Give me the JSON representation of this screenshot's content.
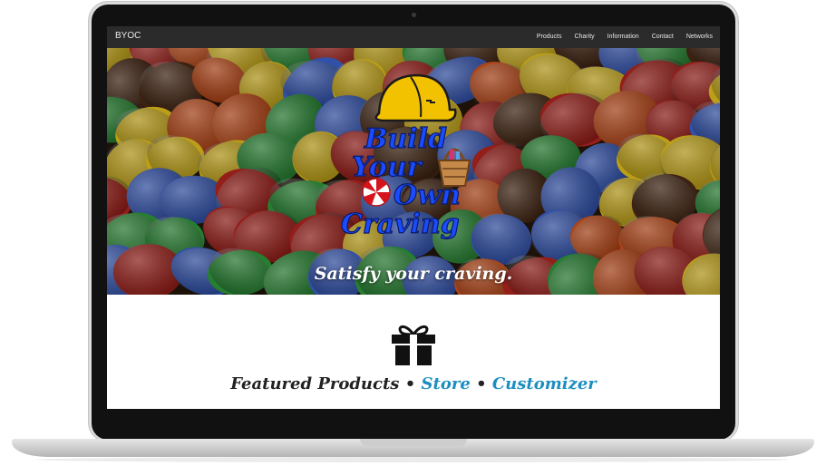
{
  "navbar": {
    "brand": "BYOC",
    "items": [
      "Products",
      "Charity",
      "Information",
      "Contact",
      "Networks"
    ]
  },
  "hero": {
    "logo_lines": [
      "Build",
      "Your",
      "Own",
      "Craving"
    ],
    "tagline": "Satisfy your craving."
  },
  "featured": {
    "icon": "gift-icon",
    "title": "Featured Products",
    "separator": "•",
    "store_link": "Store",
    "customizer_link": "Customizer"
  },
  "colors": {
    "navbar": "#2b2b2b",
    "logo_text": "#1a4bff",
    "hard_hat": "#f2c200",
    "link_blue": "#1c8fc0",
    "candy": [
      "#3c62cc",
      "#2f9a3c",
      "#e5c21e",
      "#d5531c",
      "#b5251f",
      "#4b2a15"
    ]
  }
}
